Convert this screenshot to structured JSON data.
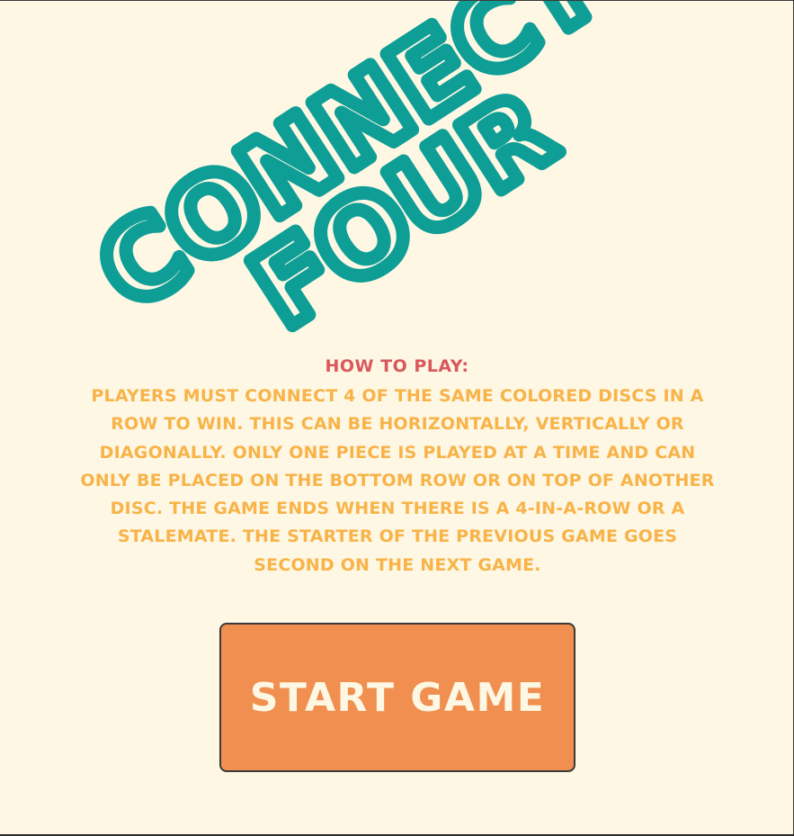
{
  "logo": {
    "line1": "CONNECT",
    "line2": "FOUR"
  },
  "instructions": {
    "heading": "How to play:",
    "body": "Players must connect 4 of the same colored discs in a row to win. This can be horizontally, vertically or diagonally. Only one piece is played at a time and can only be placed on the bottom row or on top of another disc. The game ends when there is a 4-in-a-row or a stalemate. The starter of the previous game goes second on the next game."
  },
  "actions": {
    "start_label": "Start Game"
  },
  "colors": {
    "background": "#fdf7e4",
    "logo": "#0e9e96",
    "heading": "#d9585b",
    "body_text": "#f8b349",
    "button": "#f08f4f",
    "button_text": "#fdf7e4"
  }
}
